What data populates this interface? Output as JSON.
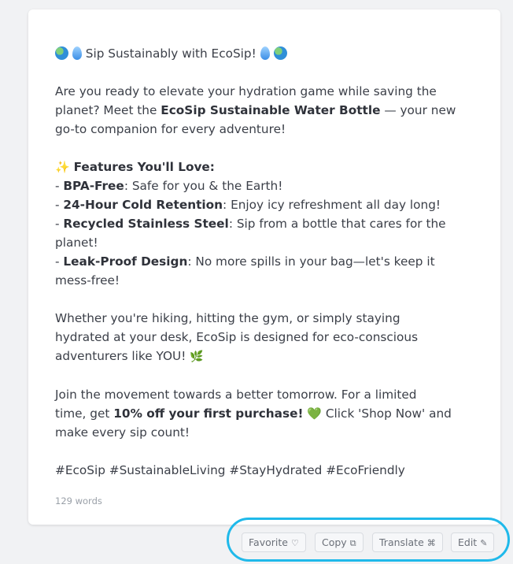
{
  "post": {
    "title": "Sip Sustainably with EcoSip!",
    "intro": {
      "l1": "Are you ready to elevate your hydration game while saving the",
      "l2_pre": "planet? Meet the ",
      "l2_bold": "EcoSip Sustainable Water Bottle",
      "l2_post": " — your new",
      "l3": "go-to companion for every adventure!"
    },
    "features": {
      "heading": "Features You'll Love:",
      "items": [
        {
          "bold": "BPA-Free",
          "text": ": Safe for you & the Earth!"
        },
        {
          "bold": "24-Hour Cold Retention",
          "text": ": Enjoy icy refreshment all day long!"
        },
        {
          "bold": "Recycled Stainless Steel",
          "text": ": Sip from a bottle that cares for the",
          "cont": "planet!"
        },
        {
          "bold": "Leak-Proof Design",
          "text": ": No more spills in your bag—let's keep it",
          "cont": "mess-free!"
        }
      ]
    },
    "body": {
      "l1": "Whether you're hiking, hitting the gym, or simply staying",
      "l2": "hydrated at your desk, EcoSip is designed for eco-conscious",
      "l3": "adventurers like YOU!"
    },
    "cta": {
      "l1": "Join the movement towards a better tomorrow. For a limited",
      "l2_pre": "time, get ",
      "l2_bold": "10% off your first purchase!",
      "l2_post": " Click 'Shop Now' and",
      "l3": "make every sip count!"
    },
    "hashtags": "#EcoSip #SustainableLiving #StayHydrated #EcoFriendly",
    "word_count": "129 words"
  },
  "actions": {
    "favorite": "Favorite",
    "copy": "Copy",
    "translate": "Translate",
    "edit": "Edit"
  },
  "icons": {
    "globe": "globe-emoji",
    "drop": "droplet-emoji",
    "sparkle": "sparkles-emoji",
    "heart": "green-heart-emoji",
    "leaf": "herb-emoji",
    "favorite": "heart-outline-icon",
    "copy": "copy-icon",
    "translate": "translate-icon",
    "edit": "pencil-icon"
  },
  "colors": {
    "annotation": "#1fb9ea",
    "text": "#3b3f48"
  }
}
